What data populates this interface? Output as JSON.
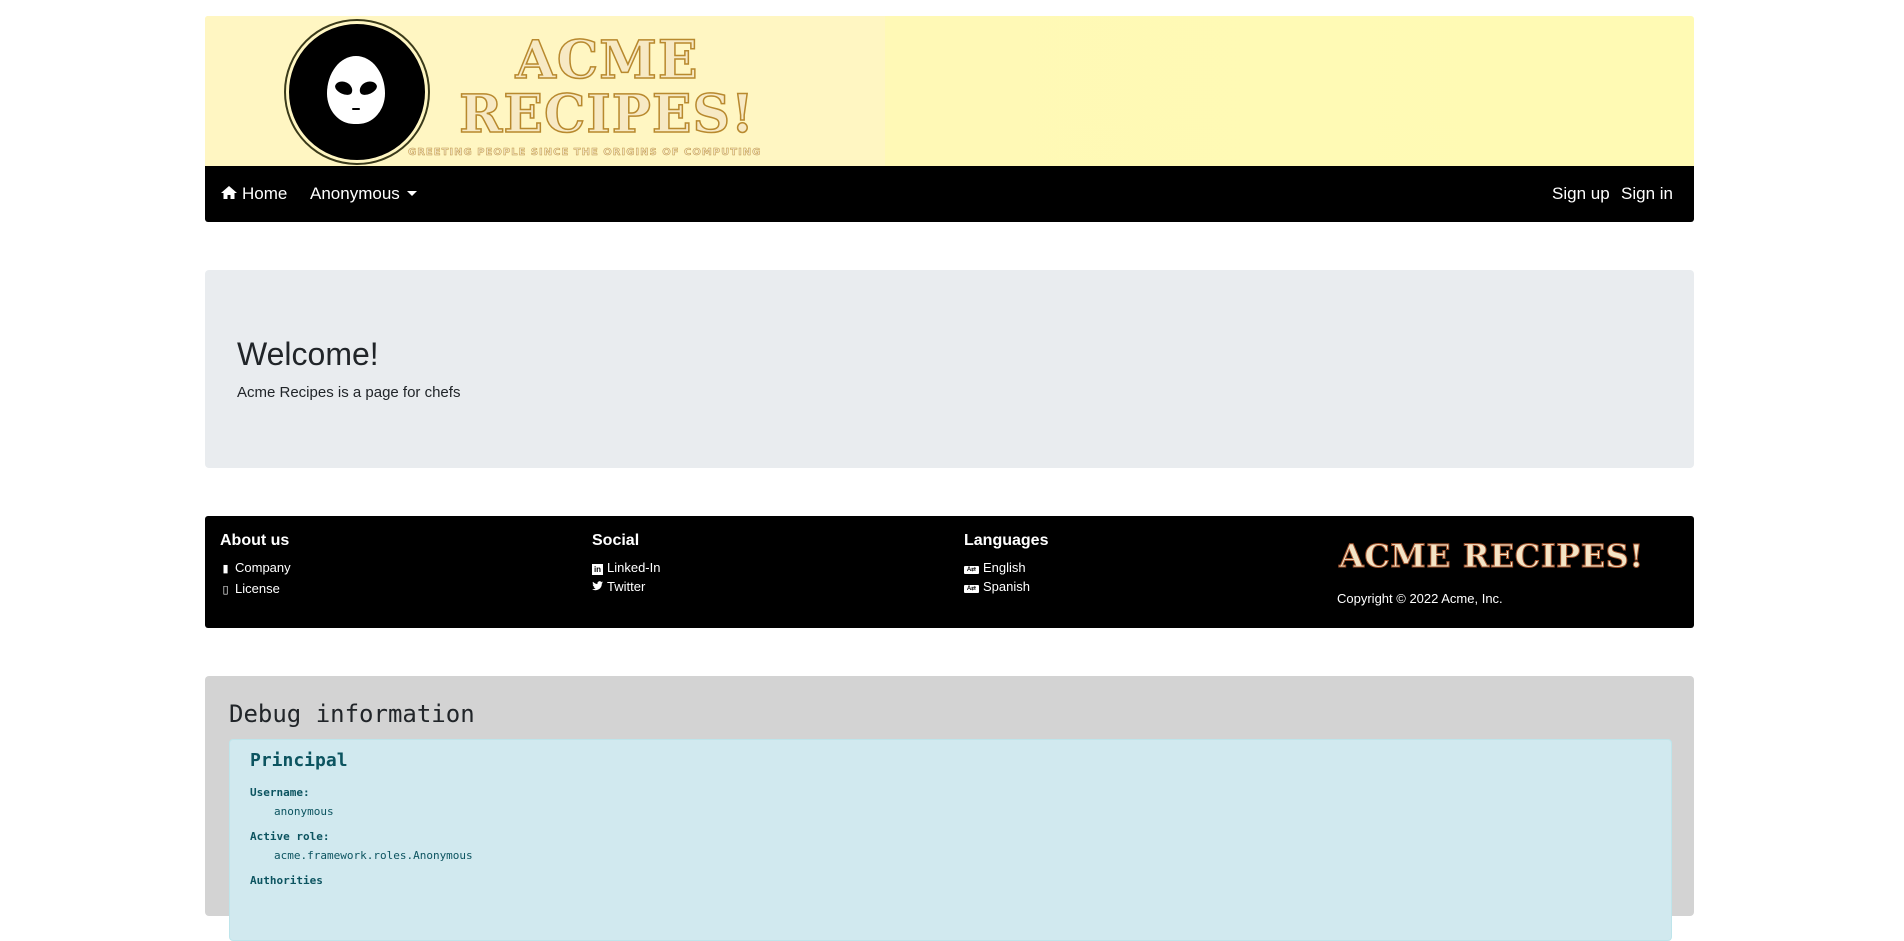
{
  "banner": {
    "title_line1": "ACME",
    "title_line2": "RECIPES!",
    "tagline": "GREETING PEOPLE SINCE THE ORIGINS OF COMPUTING",
    "logo_icon": "alien-icon",
    "background_color": "#fff9b6"
  },
  "navbar": {
    "home_label": "Home",
    "home_icon": "home-icon",
    "anonymous_label": "Anonymous",
    "signup_label": "Sign up",
    "signin_label": "Sign in"
  },
  "jumbotron": {
    "title": "Welcome!",
    "text": "Acme Recipes is a page for chefs"
  },
  "footer": {
    "about": {
      "heading": "About us",
      "items": [
        {
          "label": "Company",
          "icon": "building-icon"
        },
        {
          "label": "License",
          "icon": "file-icon"
        }
      ]
    },
    "social": {
      "heading": "Social",
      "items": [
        {
          "label": "Linked-In",
          "icon": "linkedin-icon"
        },
        {
          "label": "Twitter",
          "icon": "twitter-icon"
        }
      ]
    },
    "languages": {
      "heading": "Languages",
      "items": [
        {
          "label": "English",
          "icon": "language-icon"
        },
        {
          "label": "Spanish",
          "icon": "language-icon"
        }
      ]
    },
    "brand": "ACME RECIPES!",
    "copyright": "Copyright © 2022 Acme, Inc."
  },
  "debug": {
    "heading": "Debug information",
    "principal": {
      "heading": "Principal",
      "username_label": "Username:",
      "username_value": "anonymous",
      "role_label": "Active role:",
      "role_value": "acme.framework.roles.Anonymous",
      "authorities_label": "Authorities"
    }
  }
}
